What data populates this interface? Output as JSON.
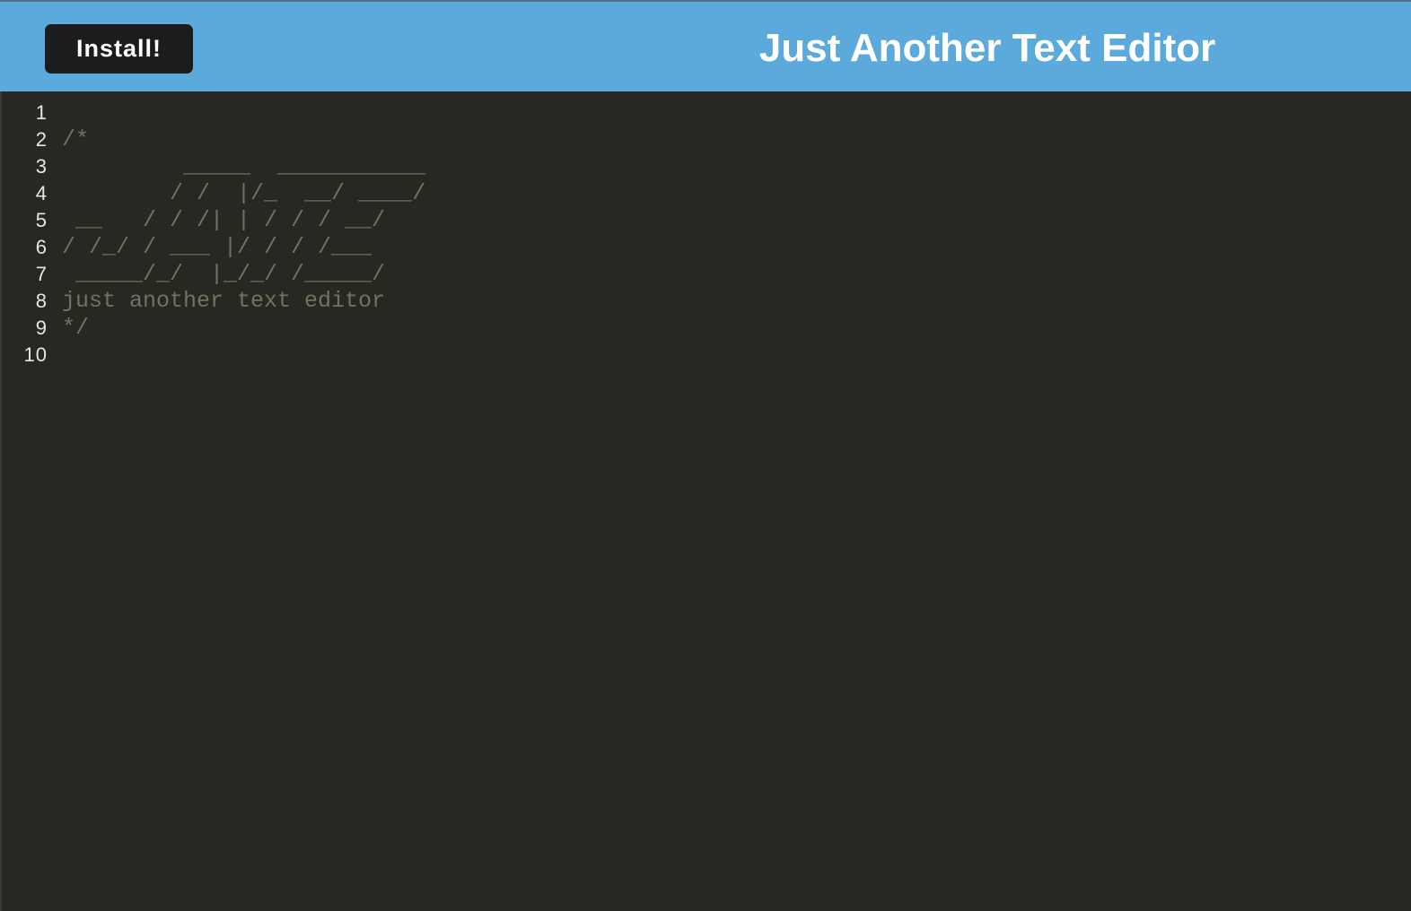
{
  "header": {
    "install_label": "Install!",
    "title": "Just Another Text Editor",
    "background_color": "#5ca9dc"
  },
  "editor": {
    "theme_background": "#272822",
    "comment_color": "#75715e",
    "line_numbers": [
      "1",
      "2",
      "3",
      "4",
      "5",
      "6",
      "7",
      "8",
      "9",
      "10"
    ],
    "lines": [
      "",
      "/*",
      "         _____  ___________",
      "        / /  |/_  __/ ____/",
      " __   / / /| | / / / __/",
      "/ /_/ / ___ |/ / / /___",
      " _____/_/  |_/_/ /_____/",
      "just another text editor",
      "*/",
      ""
    ]
  }
}
